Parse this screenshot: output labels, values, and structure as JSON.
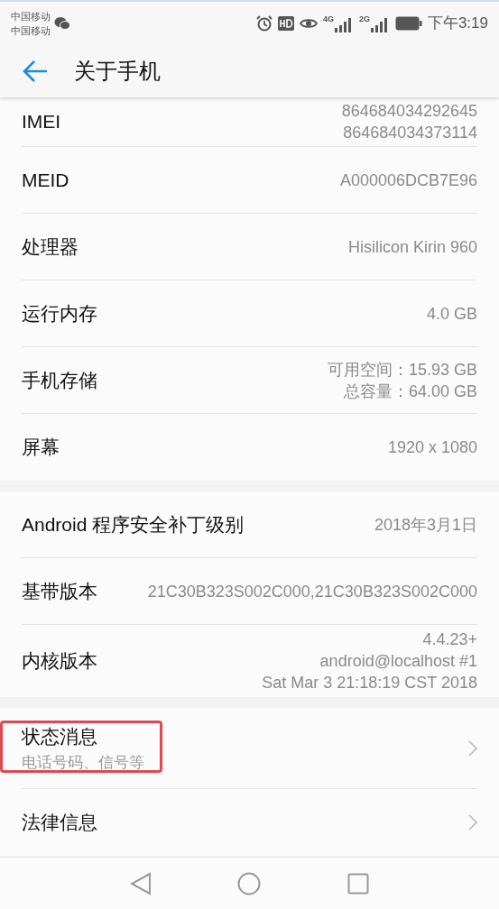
{
  "status_bar": {
    "carriers": [
      "中国移动",
      "中国移动"
    ],
    "network_1": "4G",
    "network_2": "2G",
    "time": "下午3:19"
  },
  "header": {
    "title": "关于手机"
  },
  "sections": [
    {
      "rows": [
        {
          "label": "IMEI",
          "values": [
            "864684034292645",
            "864684034373114"
          ],
          "arrow": false,
          "highlighted": false
        },
        {
          "label": "MEID",
          "values": [
            "A000006DCB7E96"
          ],
          "arrow": false,
          "highlighted": false
        },
        {
          "label": "处理器",
          "values": [
            "Hisilicon Kirin 960"
          ],
          "arrow": false,
          "highlighted": false
        },
        {
          "label": "运行内存",
          "values": [
            "4.0 GB"
          ],
          "arrow": false,
          "highlighted": false
        },
        {
          "label": "手机存储",
          "values": [
            "可用空间：15.93  GB",
            "总容量：64.00  GB"
          ],
          "arrow": false,
          "highlighted": false
        },
        {
          "label": "屏幕",
          "values": [
            "1920 x 1080"
          ],
          "arrow": false,
          "highlighted": false
        }
      ]
    },
    {
      "rows": [
        {
          "label": "Android 程序安全补丁级别",
          "values": [
            "2018年3月1日"
          ],
          "arrow": false,
          "highlighted": false
        },
        {
          "label": "基带版本",
          "values": [
            "21C30B323S002C000,21C30B323S002C000"
          ],
          "arrow": false,
          "highlighted": false
        },
        {
          "label": "内核版本",
          "values": [
            "4.4.23+",
            "android@localhost #1",
            "Sat Mar 3 21:18:19 CST 2018"
          ],
          "arrow": false,
          "highlighted": false
        }
      ]
    },
    {
      "rows": [
        {
          "label": "状态消息",
          "subtitle": "电话号码、信号等",
          "arrow": true,
          "highlighted": true
        },
        {
          "label": "法律信息",
          "arrow": true,
          "highlighted": false
        }
      ]
    }
  ]
}
